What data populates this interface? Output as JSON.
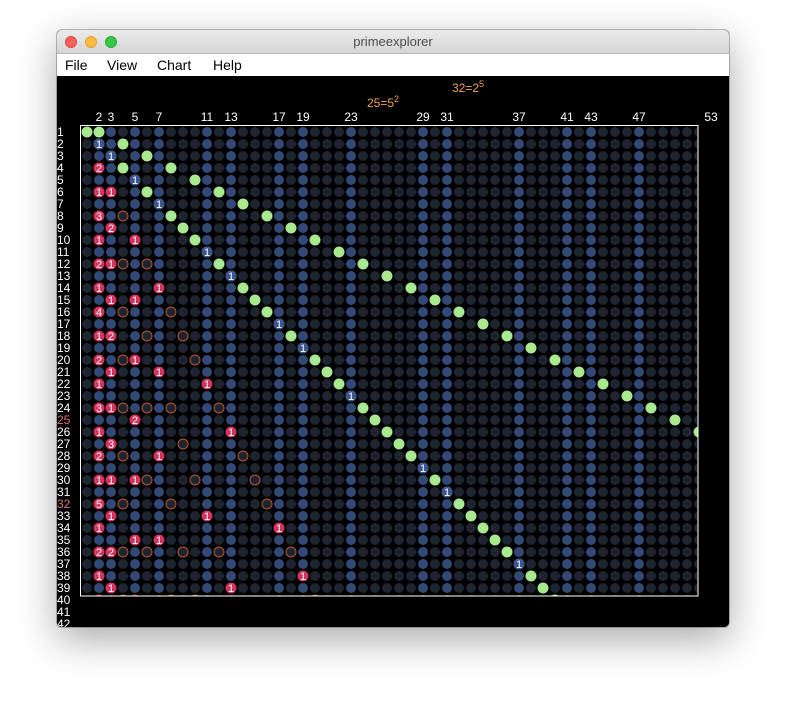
{
  "window": {
    "title": "primeexplorer"
  },
  "menu": [
    "File",
    "View",
    "Chart",
    "Help"
  ],
  "annotations": [
    {
      "base": "25=5",
      "exp": "2"
    },
    {
      "base": "32=2",
      "exp": "5"
    }
  ],
  "primes": [
    2,
    3,
    5,
    7,
    11,
    13,
    17,
    19,
    23,
    29,
    31,
    37,
    41,
    43,
    47,
    53
  ],
  "visible_rows": 42,
  "highlight_rows": [
    25,
    32
  ],
  "colors": {
    "prime_marker": "#a8e890",
    "factor_badge": "#d6325e",
    "self_marker": "#3c5690",
    "column_dot_dark": "#1e2530",
    "column_dot_blue": "#324876",
    "ring": "#b85830",
    "annotation_text": "#f0a050",
    "row_label": "#ffffff",
    "row_label_highlight": "#e07070"
  }
}
